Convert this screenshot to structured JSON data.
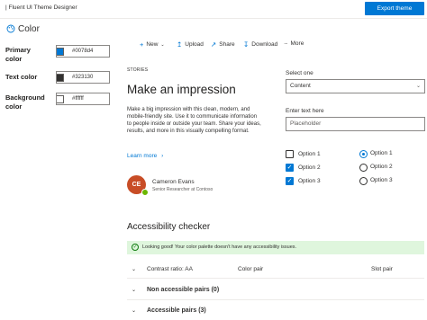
{
  "header": {
    "app_title": "| Fluent UI Theme Designer",
    "export_label": "Export theme"
  },
  "color_panel": {
    "title": "Color",
    "rows": [
      {
        "label": "Primary color",
        "hex": "#0078d4",
        "swatch": "#0078d4"
      },
      {
        "label": "Text color",
        "hex": "#323130",
        "swatch": "#323130"
      },
      {
        "label": "Background color",
        "hex": "#ffffff",
        "swatch": "#ffffff"
      }
    ]
  },
  "command_bar": {
    "new": "New",
    "upload": "Upload",
    "share": "Share",
    "download": "Download",
    "more": "More"
  },
  "card": {
    "eyebrow": "STORIES",
    "headline": "Make an impression",
    "body": "Make a big impression with this clean, modern, and mobile-friendly site. Use it to communicate information to people inside or outside your team. Share your ideas, results, and more in this visually compelling format.",
    "learn_more": "Learn more",
    "person": {
      "initials": "CE",
      "name": "Cameron Evans",
      "role": "Senior Researcher at Contoso"
    }
  },
  "form": {
    "select_label": "Select one",
    "select_value": "Content",
    "text_label": "Enter text here",
    "text_placeholder": "Placeholder",
    "checkboxes": [
      {
        "label": "Option 1",
        "checked": false
      },
      {
        "label": "Option 2",
        "checked": true
      },
      {
        "label": "Option 3",
        "checked": true
      }
    ],
    "radios": [
      {
        "label": "Option 1",
        "selected": true
      },
      {
        "label": "Option 2",
        "selected": false
      },
      {
        "label": "Option 3",
        "selected": false
      }
    ]
  },
  "accessibility": {
    "title": "Accessibility checker",
    "message": "Looking good! Your color palette doesn't have any accessibility issues.",
    "col_contrast": "Contrast ratio: AA",
    "col_color_pair": "Color pair",
    "col_slot_pair": "Slot pair",
    "group_non_accessible": "Non accessible pairs (0)",
    "group_accessible": "Accessible pairs (3)"
  },
  "colors": {
    "accent": "#0078d4",
    "success_bg": "#dff6dd",
    "avatar_bg": "#c84d26"
  }
}
